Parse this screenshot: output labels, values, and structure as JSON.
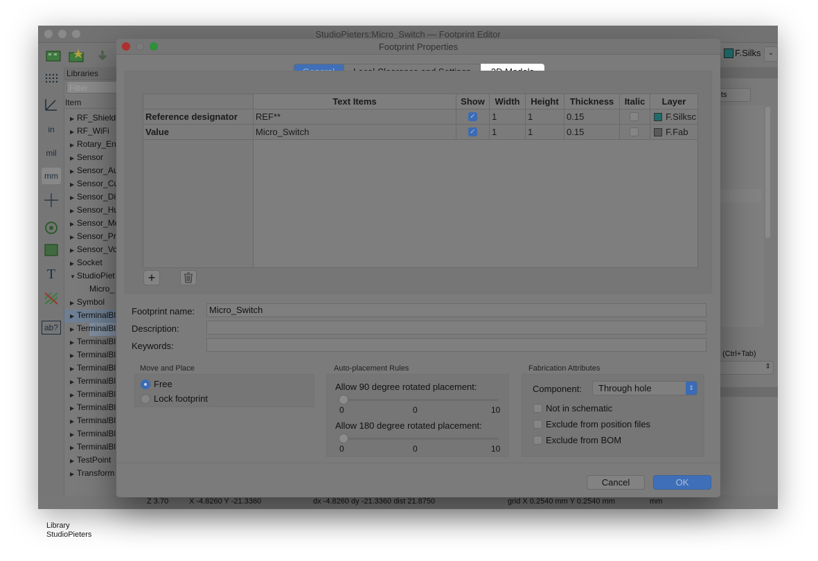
{
  "main_window": {
    "title": "StudioPieters:Micro_Switch — Footprint Editor",
    "right_layer_label": "F.Silks",
    "right_shortcut": "(Ctrl+Tab)",
    "right_tab_fragment": "ts",
    "right_text_fragment": "e",
    "library_panel": {
      "header": "Libraries",
      "filter_placeholder": "Filter",
      "column_item": "Item",
      "items": [
        "RF_Shieldi",
        "RF_WiFi",
        "Rotary_En",
        "Sensor",
        "Sensor_Au",
        "Sensor_Cu",
        "Sensor_Di",
        "Sensor_Hu",
        "Sensor_Mo",
        "Sensor_Pr",
        "Sensor_Vo",
        "Socket",
        "StudioPiet",
        "Micro_",
        "Symbol",
        "TerminalBl",
        "TerminalBl",
        "TerminalBl",
        "TerminalBl",
        "TerminalBl",
        "TerminalBl",
        "TerminalBl",
        "TerminalBl",
        "TerminalBl",
        "TerminalBl",
        "TerminalBl",
        "TestPoint",
        "Transform"
      ],
      "footer_line1": "Library",
      "footer_line2": "StudioPieters"
    },
    "left_tools": [
      "in",
      "mil",
      "mm",
      "ab?"
    ],
    "status": {
      "zoom": "Z 3.70",
      "xy": "X -4.8260  Y -21.3360",
      "delta": "dx -4.8260  dy -21.3360  dist 21.8750",
      "grid": "grid X 0.2540 mm  Y 0.2540 mm",
      "units": "mm"
    }
  },
  "dialog": {
    "title": "Footprint Properties",
    "tabs": [
      "General",
      "Local Clearance and Settings",
      "3D Models"
    ],
    "active_tab": "General",
    "table": {
      "headers": [
        "Text Items",
        "Show",
        "Width",
        "Height",
        "Thickness",
        "Italic",
        "Layer"
      ],
      "rows": [
        {
          "label": "Reference designator",
          "text": "REF**",
          "show": true,
          "width": "1",
          "height": "1",
          "thickness": "0.15",
          "italic": false,
          "layer": "F.Silksc",
          "layer_color": "#1f6a6a"
        },
        {
          "label": "Value",
          "text": "Micro_Switch",
          "show": true,
          "width": "1",
          "height": "1",
          "thickness": "0.15",
          "italic": false,
          "layer": "F.Fab",
          "layer_color": "#5a5a5a"
        }
      ]
    },
    "fields": {
      "footprint_name_label": "Footprint name:",
      "footprint_name_value": "Micro_Switch",
      "description_label": "Description:",
      "description_value": "",
      "keywords_label": "Keywords:",
      "keywords_value": ""
    },
    "move_place": {
      "title": "Move and Place",
      "options": [
        "Free",
        "Lock footprint"
      ],
      "selected": "Free"
    },
    "auto_place": {
      "title": "Auto-placement Rules",
      "rule90_label": "Allow 90 degree rotated placement:",
      "rule90_value": 0,
      "rule180_label": "Allow 180 degree rotated placement:",
      "rule180_value": 0,
      "scale_min": "0",
      "scale_mid": "0",
      "scale_max": "10"
    },
    "fabrication": {
      "title": "Fabrication Attributes",
      "component_label": "Component:",
      "component_value": "Through hole",
      "checks": [
        "Not in schematic",
        "Exclude from position files",
        "Exclude from BOM"
      ]
    },
    "buttons": {
      "cancel": "Cancel",
      "ok": "OK"
    }
  },
  "colors": {
    "accent": "#3b6bb5",
    "ok_button": "#3f6fb8"
  }
}
